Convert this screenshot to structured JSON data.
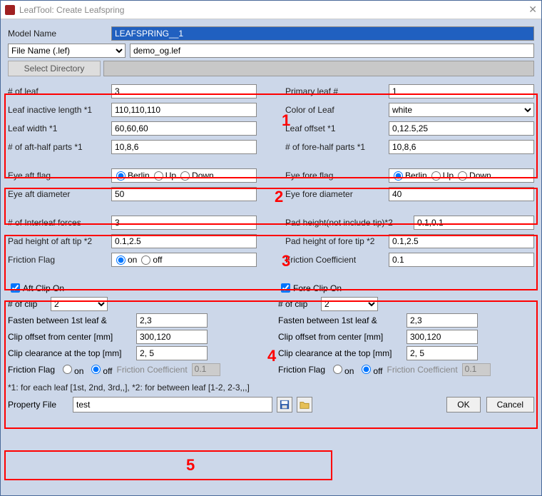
{
  "title": "LeafTool: Create Leafspring",
  "modelName": {
    "label": "Model Name",
    "value": "LEAFSPRING__1"
  },
  "fileType": {
    "selected": "File Name (.lef)"
  },
  "fileName": "demo_og.lef",
  "selectDir": "Select Directory",
  "section1": {
    "nLeaf": {
      "label": "# of leaf",
      "value": "3"
    },
    "primary": {
      "label": "Primary leaf #",
      "value": "1"
    },
    "inactive": {
      "label": "Leaf inactive length *1",
      "value": "110,110,110"
    },
    "color": {
      "label": "Color of Leaf",
      "value": "white"
    },
    "width": {
      "label": "Leaf width *1",
      "value": "60,60,60"
    },
    "offset": {
      "label": "Leaf offset *1",
      "value": "0,12.5,25"
    },
    "aftHalf": {
      "label": "# of aft-half parts *1",
      "value": "10,8,6"
    },
    "foreHalf": {
      "label": "# of fore-half parts *1",
      "value": "10,8,6"
    }
  },
  "section2": {
    "eyeAftFlag": {
      "label": "Eye aft flag",
      "opts": [
        "Berlin",
        "Up",
        "Down"
      ],
      "sel": "Berlin"
    },
    "eyeForeFlag": {
      "label": "Eye fore flag",
      "opts": [
        "Berlin",
        "Up",
        "Down"
      ],
      "sel": "Berlin"
    },
    "eyeAftDia": {
      "label": "Eye aft diameter",
      "value": "50"
    },
    "eyeForeDia": {
      "label": "Eye fore diameter",
      "value": "40"
    }
  },
  "section3": {
    "interleaf": {
      "label": "# of Interleaf forces",
      "value": "3"
    },
    "padHeight": {
      "label": "Pad height(not include tip)*2",
      "value": "0.1,0.1"
    },
    "padAft": {
      "label": "Pad height of aft tip *2",
      "value": "0.1,2.5"
    },
    "padFore": {
      "label": "Pad height of fore tip *2",
      "value": "0.1,2.5"
    },
    "fflag": {
      "label": "Friction Flag",
      "opts": [
        "on",
        "off"
      ],
      "sel": "on"
    },
    "fcoef": {
      "label": "Friction Coefficient",
      "value": "0.1"
    }
  },
  "section4": {
    "aft": {
      "on": "Aft Clip On",
      "nclip": {
        "label": "# of clip",
        "value": "2"
      },
      "fasten": {
        "label": "Fasten between 1st leaf &",
        "value": "2,3"
      },
      "offset": {
        "label": "Clip offset from center [mm]",
        "value": "300,120"
      },
      "clear": {
        "label": "Clip clearance at the top [mm]",
        "value": "2, 5"
      },
      "fflag": {
        "label": "Friction Flag",
        "opts": [
          "on",
          "off"
        ],
        "sel": "off",
        "coefLabel": "Friction Coefficient",
        "coef": "0.1"
      }
    },
    "fore": {
      "on": "Fore Clip On",
      "nclip": {
        "label": "# of clip",
        "value": "2"
      },
      "fasten": {
        "label": "Fasten between 1st leaf &",
        "value": "2,3"
      },
      "offset": {
        "label": "Clip offset from center [mm]",
        "value": "300,120"
      },
      "clear": {
        "label": "Clip clearance at the top [mm]",
        "value": "2, 5"
      },
      "fflag": {
        "label": "Friction Flag",
        "opts": [
          "on",
          "off"
        ],
        "sel": "off",
        "coefLabel": "Friction Coefficient",
        "coef": "0.1"
      }
    }
  },
  "footnote": "*1: for each leaf [1st, 2nd, 3rd,,], *2: for between leaf [1-2, 2-3,,,]",
  "propFile": {
    "label": "Property File",
    "value": "test"
  },
  "buttons": {
    "ok": "OK",
    "cancel": "Cancel"
  },
  "markers": {
    "m1": "1",
    "m2": "2",
    "m3": "3",
    "m4": "4",
    "m5": "5"
  }
}
